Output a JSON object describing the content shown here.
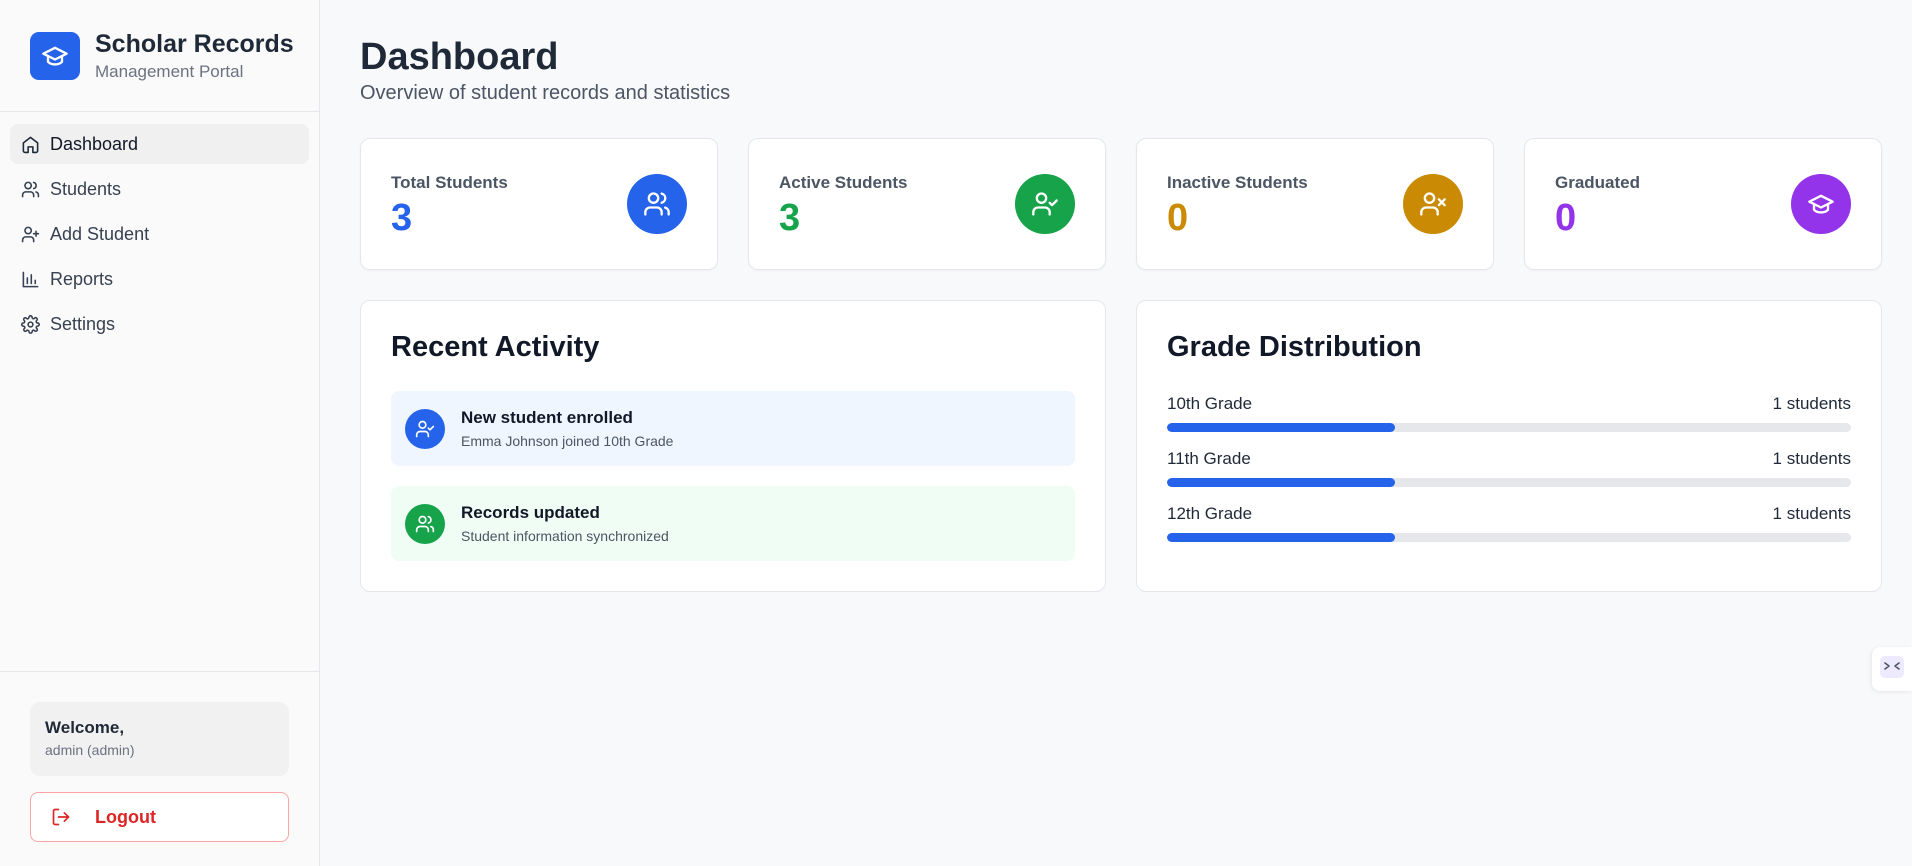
{
  "brand": {
    "title": "Scholar Records",
    "subtitle": "Management Portal",
    "icon": "graduation-cap-icon"
  },
  "nav": {
    "items": [
      {
        "label": "Dashboard",
        "icon": "home-icon",
        "active": true
      },
      {
        "label": "Students",
        "icon": "users-icon",
        "active": false
      },
      {
        "label": "Add Student",
        "icon": "user-plus-icon",
        "active": false
      },
      {
        "label": "Reports",
        "icon": "bar-chart-icon",
        "active": false
      },
      {
        "label": "Settings",
        "icon": "gear-icon",
        "active": false
      }
    ]
  },
  "user": {
    "welcome": "Welcome,",
    "name": "admin (admin)"
  },
  "logout_label": "Logout",
  "page": {
    "title": "Dashboard",
    "subtitle": "Overview of student records and statistics"
  },
  "stats": [
    {
      "label": "Total Students",
      "value": "3",
      "color": "#2563eb",
      "icon": "users-icon"
    },
    {
      "label": "Active Students",
      "value": "3",
      "color": "#16a34a",
      "icon": "user-check-icon"
    },
    {
      "label": "Inactive Students",
      "value": "0",
      "color": "#ca8a04",
      "icon": "user-x-icon"
    },
    {
      "label": "Graduated",
      "value": "0",
      "color": "#9333ea",
      "icon": "graduation-cap-icon"
    }
  ],
  "activity": {
    "title": "Recent Activity",
    "items": [
      {
        "title": "New student enrolled",
        "detail": "Emma Johnson joined 10th Grade",
        "color": "#2563eb",
        "bg": "#eff6ff",
        "icon": "user-check-icon"
      },
      {
        "title": "Records updated",
        "detail": "Student information synchronized",
        "color": "#16a34a",
        "bg": "#f0fdf4",
        "icon": "users-icon"
      }
    ]
  },
  "grades": {
    "title": "Grade Distribution",
    "items": [
      {
        "label": "10th Grade",
        "count": "1 students",
        "fraction": 0.333
      },
      {
        "label": "11th Grade",
        "count": "1 students",
        "fraction": 0.333
      },
      {
        "label": "12th Grade",
        "count": "1 students",
        "fraction": 0.333
      }
    ]
  }
}
